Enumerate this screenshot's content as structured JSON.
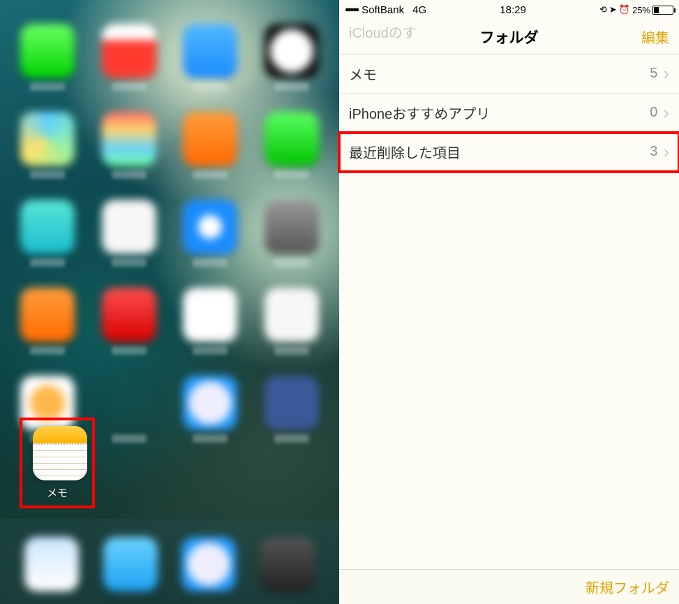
{
  "left": {
    "notes_app_label": "メモ"
  },
  "status": {
    "carrier": "SoftBank",
    "network": "4G",
    "time": "18:29",
    "battery_pct": "25%",
    "signal_dots": "●●●●●"
  },
  "nav": {
    "ghost_text": "iCloudのす",
    "title": "フォルダ",
    "edit": "編集"
  },
  "folders": [
    {
      "name": "メモ",
      "count": "5"
    },
    {
      "name": "iPhoneおすすめアプリ",
      "count": "0"
    },
    {
      "name": "最近削除した項目",
      "count": "3"
    }
  ],
  "toolbar": {
    "new_folder": "新規フォルダ"
  }
}
